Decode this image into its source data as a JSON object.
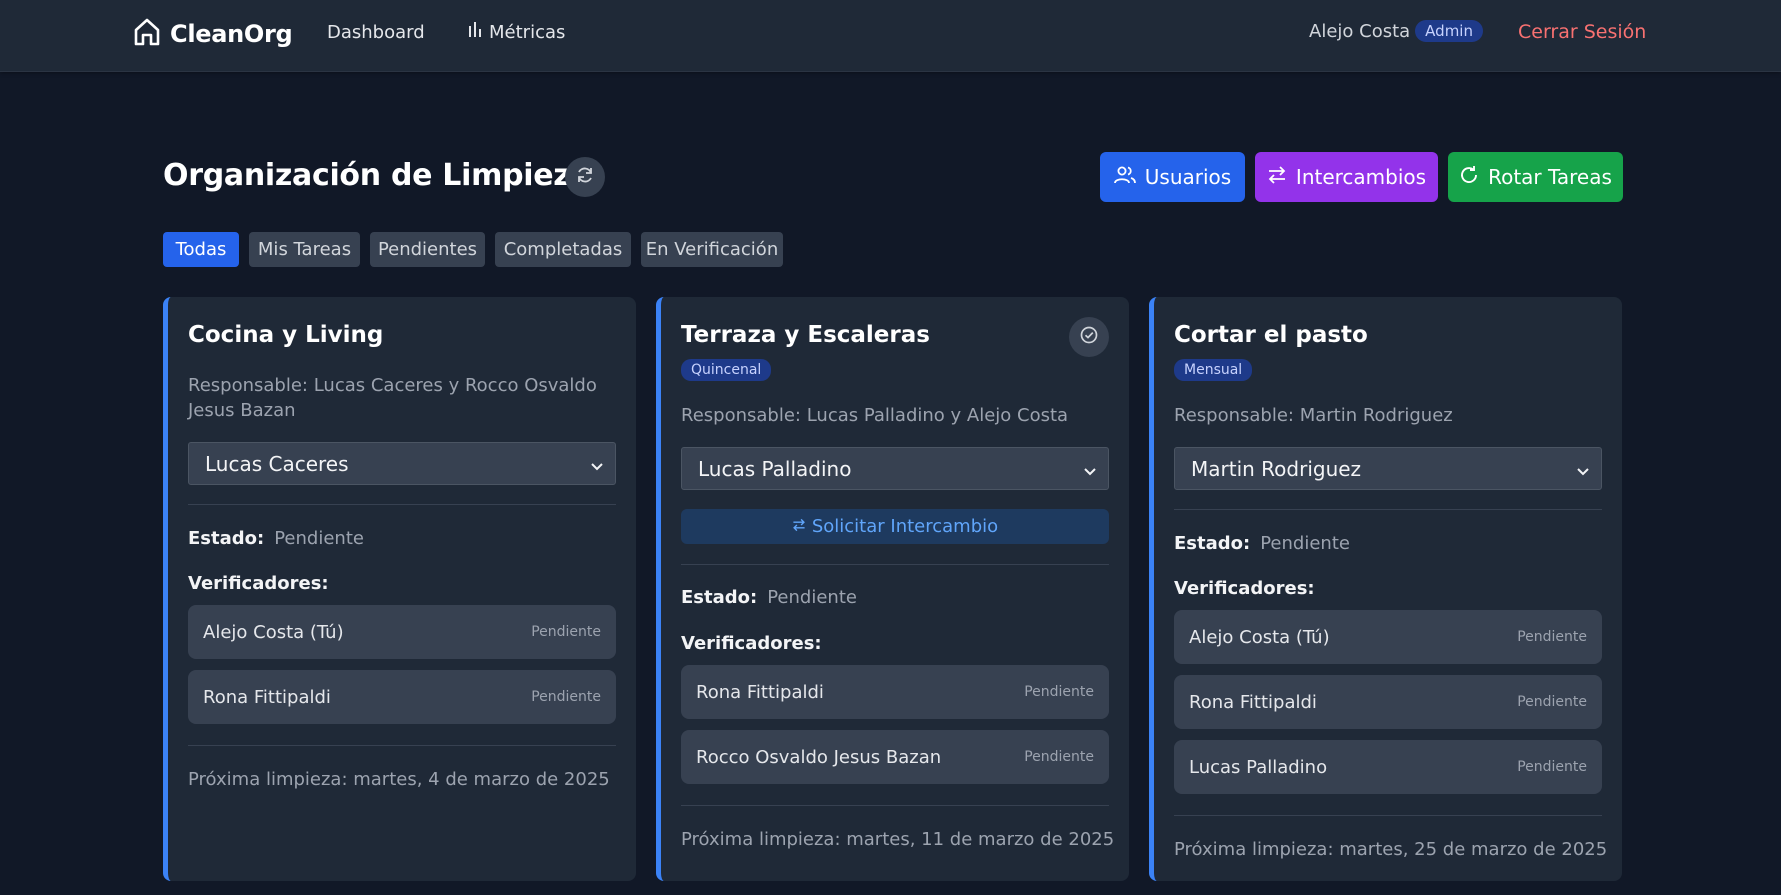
{
  "navbar": {
    "brand": "CleanOrg",
    "links": [
      {
        "label": "Dashboard",
        "icon": ""
      },
      {
        "label": "Métricas",
        "icon": "bar-chart-icon"
      }
    ],
    "user": {
      "name": "Alejo Costa",
      "role_badge": "Admin"
    },
    "logout_label": "Cerrar Sesión"
  },
  "header": {
    "title": "Organización de Limpieza",
    "buttons": {
      "users": "Usuarios",
      "exchanges": "Intercambios",
      "rotate": "Rotar Tareas"
    }
  },
  "filters": [
    "Todas",
    "Mis Tareas",
    "Pendientes",
    "Completadas",
    "En Verificación"
  ],
  "active_filter": "Todas",
  "tasks": [
    {
      "title": "Cocina y Living",
      "frequency": "",
      "responsable": "Responsable: Lucas Caceres y Rocco Osvaldo Jesus Bazan",
      "selected": "Lucas Caceres",
      "estado_label": "Estado:",
      "estado": "Pendiente",
      "verificadores_label": "Verificadores:",
      "verificadores": [
        {
          "name": "Alejo Costa (Tú)",
          "status": "Pendiente"
        },
        {
          "name": "Rona Fittipaldi",
          "status": "Pendiente"
        }
      ],
      "next": "Próxima limpieza: martes, 4 de marzo de 2025"
    },
    {
      "title": "Terraza y Escaleras",
      "frequency": "Quincenal",
      "responsable": "Responsable: Lucas Palladino y Alejo Costa",
      "selected": "Lucas Palladino",
      "swap_label": "Solicitar Intercambio",
      "estado_label": "Estado:",
      "estado": "Pendiente",
      "verificadores_label": "Verificadores:",
      "verificadores": [
        {
          "name": "Rona Fittipaldi",
          "status": "Pendiente"
        },
        {
          "name": "Rocco Osvaldo Jesus Bazan",
          "status": "Pendiente"
        }
      ],
      "next": "Próxima limpieza: martes, 11 de marzo de 2025"
    },
    {
      "title": "Cortar el pasto",
      "frequency": "Mensual",
      "responsable": "Responsable: Martin Rodriguez",
      "selected": "Martin Rodriguez",
      "estado_label": "Estado:",
      "estado": "Pendiente",
      "verificadores_label": "Verificadores:",
      "verificadores": [
        {
          "name": "Alejo Costa (Tú)",
          "status": "Pendiente"
        },
        {
          "name": "Rona Fittipaldi",
          "status": "Pendiente"
        },
        {
          "name": "Lucas Palladino",
          "status": "Pendiente"
        }
      ],
      "next": "Próxima limpieza: martes, 25 de marzo de 2025"
    }
  ],
  "colors": {
    "background": "#111827",
    "surface": "#1f2937",
    "accent_blue": "#2563eb",
    "accent_purple": "#9333ea",
    "accent_green": "#16a34a",
    "danger": "#f87171",
    "card_border": "#3b82f6"
  }
}
